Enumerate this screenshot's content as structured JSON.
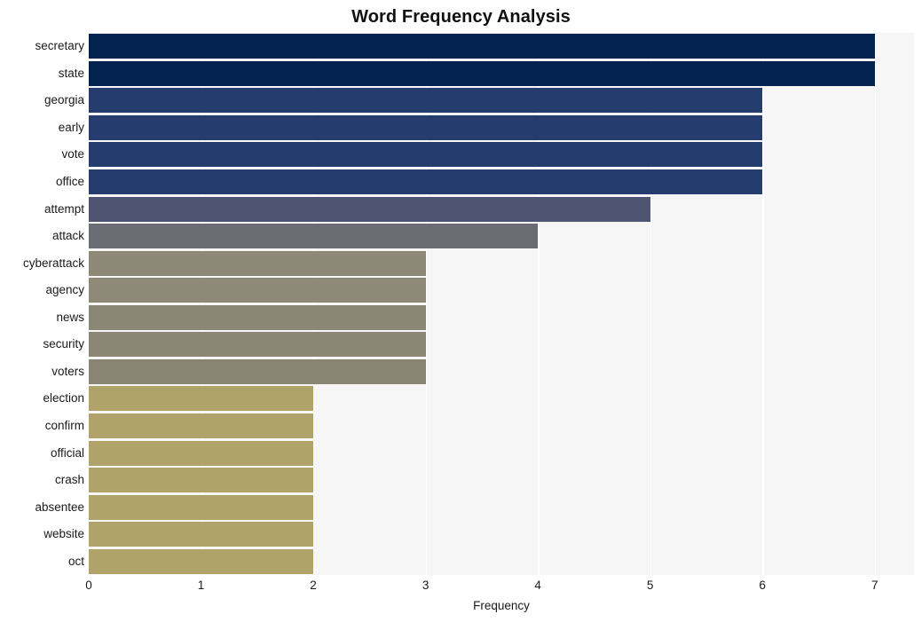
{
  "chart_data": {
    "type": "bar",
    "orientation": "horizontal",
    "title": "Word Frequency Analysis",
    "xlabel": "Frequency",
    "ylabel": "",
    "xlim": [
      0,
      7.35
    ],
    "ylim": [
      0,
      20
    ],
    "grid": true,
    "legend": null,
    "xticks": [
      "0",
      "1",
      "2",
      "3",
      "4",
      "5",
      "6",
      "7"
    ],
    "xtick_values": [
      0,
      1,
      2,
      3,
      4,
      5,
      6,
      7
    ],
    "categories": [
      "secretary",
      "state",
      "georgia",
      "early",
      "vote",
      "office",
      "attempt",
      "attack",
      "cyberattack",
      "agency",
      "news",
      "security",
      "voters",
      "election",
      "confirm",
      "official",
      "crash",
      "absentee",
      "website",
      "oct"
    ],
    "values": [
      7,
      7,
      6,
      6,
      6,
      6,
      5,
      4,
      3,
      3,
      3,
      3,
      3,
      2,
      2,
      2,
      2,
      2,
      2,
      2
    ],
    "bar_colors": [
      "#04234f",
      "#04234f",
      "#243d6e",
      "#243d6e",
      "#243d6e",
      "#243d6e",
      "#4e5471",
      "#6b6d74",
      "#8d8878",
      "#8e8978",
      "#8b8777",
      "#8b8676",
      "#898474",
      "#b0a369",
      "#b0a369",
      "#b0a369",
      "#b0a369",
      "#b0a369",
      "#b0a369",
      "#b0a369"
    ],
    "plot_background": "#f6f6f7",
    "figure_background": "#ffffff",
    "gridline_color": "#ffffff",
    "text_color": "#1a1a1a"
  }
}
